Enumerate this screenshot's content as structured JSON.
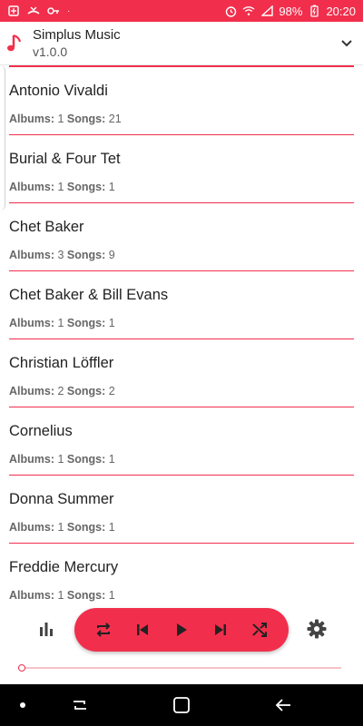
{
  "status_bar": {
    "battery": "98%",
    "time": "20:20"
  },
  "header": {
    "title": "Simplus Music",
    "version": "v1.0.0"
  },
  "artists": [
    {
      "name": "Antonio Vivaldi",
      "albums_label": "Albums:",
      "albums": "1",
      "songs_label": "Songs:",
      "songs": "21"
    },
    {
      "name": "Burial & Four Tet",
      "albums_label": "Albums:",
      "albums": "1",
      "songs_label": "Songs:",
      "songs": "1"
    },
    {
      "name": "Chet Baker",
      "albums_label": "Albums:",
      "albums": "3",
      "songs_label": "Songs:",
      "songs": "9"
    },
    {
      "name": "Chet Baker & Bill Evans",
      "albums_label": "Albums:",
      "albums": "1",
      "songs_label": "Songs:",
      "songs": "1"
    },
    {
      "name": "Christian Löffler",
      "albums_label": "Albums:",
      "albums": "2",
      "songs_label": "Songs:",
      "songs": "2"
    },
    {
      "name": "Cornelius",
      "albums_label": "Albums:",
      "albums": "1",
      "songs_label": "Songs:",
      "songs": "1"
    },
    {
      "name": "Donna Summer",
      "albums_label": "Albums:",
      "albums": "1",
      "songs_label": "Songs:",
      "songs": "1"
    },
    {
      "name": "Freddie Mercury",
      "albums_label": "Albums:",
      "albums": "1",
      "songs_label": "Songs:",
      "songs": "1"
    }
  ],
  "player": {
    "progress": 0
  },
  "colors": {
    "accent": "#f12f4d",
    "nav_background": "#000000"
  },
  "icons": [
    "music-note-icon",
    "chevron-down-icon",
    "equalizer-icon",
    "repeat-icon",
    "skip-previous-icon",
    "play-icon",
    "skip-next-icon",
    "shuffle-icon",
    "settings-icon",
    "nav-recents-icon",
    "nav-home-icon",
    "nav-back-icon"
  ]
}
